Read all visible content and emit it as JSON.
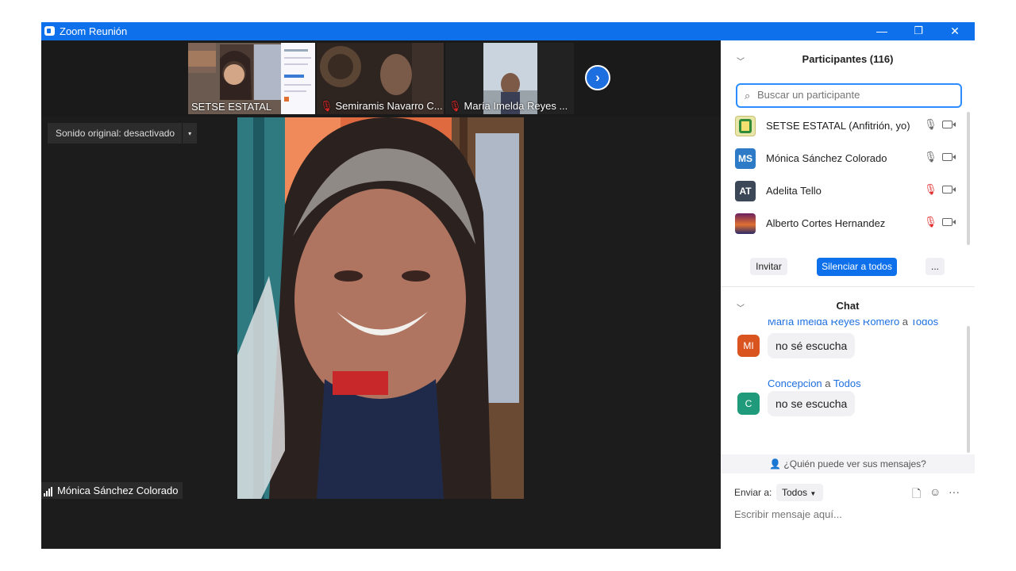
{
  "titlebar": {
    "title": "Zoom Reunión",
    "minimize": "—",
    "restore": "❐",
    "close": "✕"
  },
  "thumbnails": [
    {
      "name": "SETSE ESTATAL",
      "muted": false
    },
    {
      "name": "Semiramis Navarro C...",
      "muted": true
    },
    {
      "name": "María Imelda Reyes ...",
      "muted": true
    }
  ],
  "next_label": "›",
  "original_sound": {
    "label": "Sonido original: desactivado",
    "caret": "▾"
  },
  "active_speaker": {
    "name": "Mónica Sánchez Colorado"
  },
  "participants": {
    "title": "Participantes (116)",
    "search_placeholder": "Buscar un participante",
    "list": [
      {
        "initials": "",
        "name": "SETSE ESTATAL (Anfitrión, yo)",
        "avatar_color": "#e8e6a8",
        "muted": false
      },
      {
        "initials": "MS",
        "name": "Mónica Sánchez Colorado",
        "avatar_color": "#2d7bc6",
        "muted": false
      },
      {
        "initials": "AT",
        "name": "Adelita Tello",
        "avatar_color": "#3c4858",
        "muted": true
      },
      {
        "initials": "",
        "name": "Alberto Cortes Hernandez",
        "avatar_color": "#8a2b6e",
        "muted": true
      }
    ],
    "invite": "Invitar",
    "mute_all": "Silenciar a todos",
    "more": "..."
  },
  "chat": {
    "title": "Chat",
    "messages": [
      {
        "initials": "MI",
        "avatar_color": "#d9541e",
        "sender": "María Imelda Reyes Romero",
        "to_word": "a",
        "recipient": "Todos",
        "text": "no sé  escucha"
      },
      {
        "initials": "C",
        "avatar_color": "#1f9a7a",
        "sender": "Concepcion",
        "to_word": "a",
        "recipient": "Todos",
        "text": "no se escucha"
      }
    ],
    "who_can_see": "¿Quién puede ver sus mensajes?",
    "send_to_label": "Enviar a:",
    "send_to_value": "Todos",
    "input_placeholder": "Escribir mensaje aquí..."
  },
  "colors": {
    "accent": "#0e71eb",
    "muted_mic": "#e02828",
    "meeting_bg": "#1c1c1c"
  }
}
